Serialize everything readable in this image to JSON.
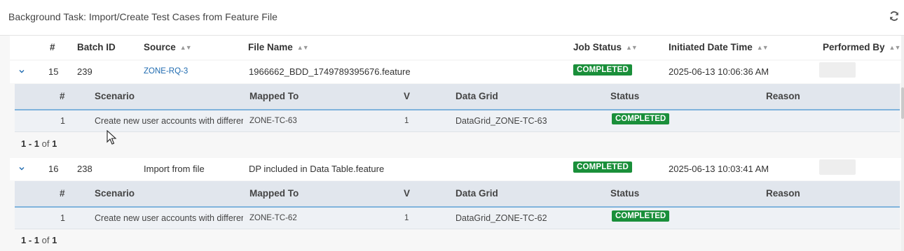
{
  "panel": {
    "title": "Background Task: Import/Create Test Cases from Feature File",
    "refresh_icon": "refresh-icon"
  },
  "columns": {
    "num": "#",
    "batch_id": "Batch ID",
    "source": "Source",
    "file_name": "File Name",
    "job_status": "Job Status",
    "initiated": "Initiated Date Time",
    "performed_by": "Performed By"
  },
  "sub_columns": {
    "num": "#",
    "scenario": "Scenario",
    "mapped_to": "Mapped To",
    "v": "V",
    "data_grid": "Data Grid",
    "status": "Status",
    "reason": "Reason"
  },
  "rows": [
    {
      "num": "15",
      "batch_id": "239",
      "source": "ZONE-RQ-3",
      "file_name": "1966662_BDD_1749789395676.feature",
      "job_status": "COMPLETED",
      "initiated": "2025-06-13 10:06:36 AM",
      "details": [
        {
          "num": "1",
          "scenario": "Create new user accounts with different roles",
          "mapped_to": "ZONE-TC-63",
          "v": "1",
          "data_grid": "DataGrid_ZONE-TC-63",
          "status": "COMPLETED",
          "reason": ""
        }
      ],
      "pager": {
        "range": "1 - 1",
        "of": "of",
        "total": "1"
      }
    },
    {
      "num": "16",
      "batch_id": "238",
      "source": "Import from file",
      "file_name": "DP included in Data Table.feature",
      "job_status": "COMPLETED",
      "initiated": "2025-06-13 10:03:41 AM",
      "details": [
        {
          "num": "1",
          "scenario": "Create new user accounts with different roles",
          "mapped_to": "ZONE-TC-62",
          "v": "1",
          "data_grid": "DataGrid_ZONE-TC-62",
          "status": "COMPLETED",
          "reason": ""
        }
      ],
      "pager": {
        "range": "1 - 1",
        "of": "of",
        "total": "1"
      }
    }
  ],
  "colors": {
    "completed": "#1a8f3a",
    "link": "#1f6bb0",
    "subheader": "#e1e6ed",
    "accent_border": "#7fb3dc"
  }
}
